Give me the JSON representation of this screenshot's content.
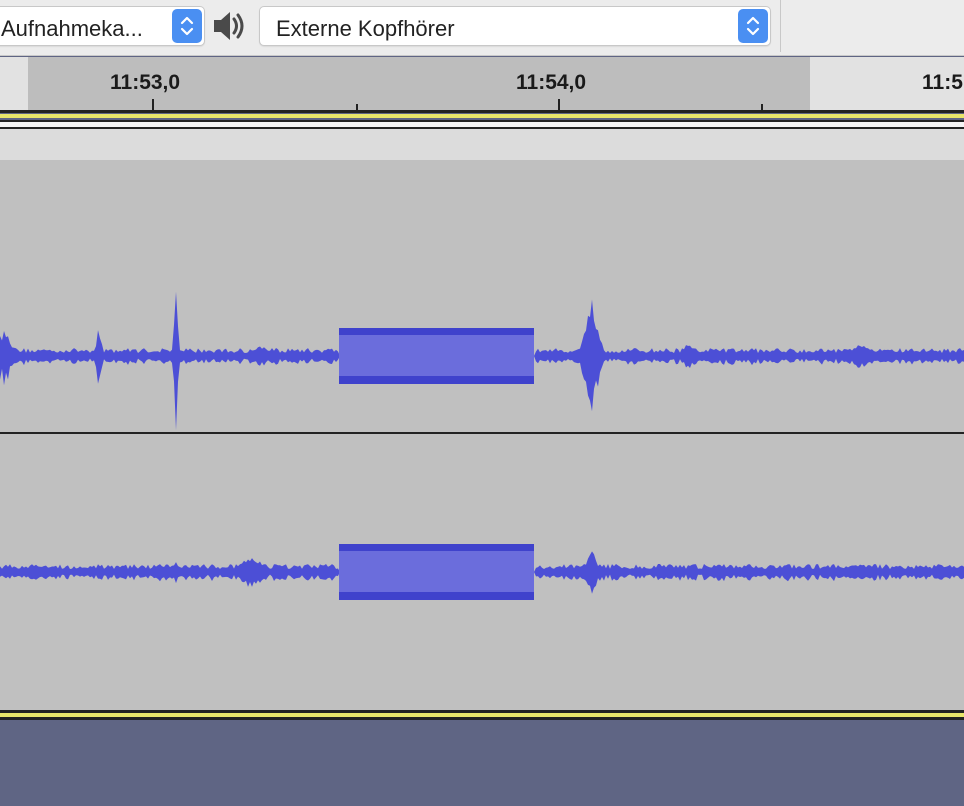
{
  "toolbar": {
    "recording_channels": "Aufnahmeka...",
    "output_device": "Externe Kopfhörer",
    "speaker_icon": "speaker-icon",
    "stepper_icon": "up-down-chevron-icon"
  },
  "timeline": {
    "labels": [
      "11:53,0",
      "11:54,0",
      "11:5"
    ]
  },
  "colors": {
    "waveform": "#4c4fd6",
    "waveform_clip": "#6b6ddc",
    "track_background": "#c0c0c0",
    "ruler_background": "#bdbdbd",
    "empty_area": "#5f6584",
    "accent_yellow": "#e8e56a",
    "stepper": "#4a8ff2"
  }
}
